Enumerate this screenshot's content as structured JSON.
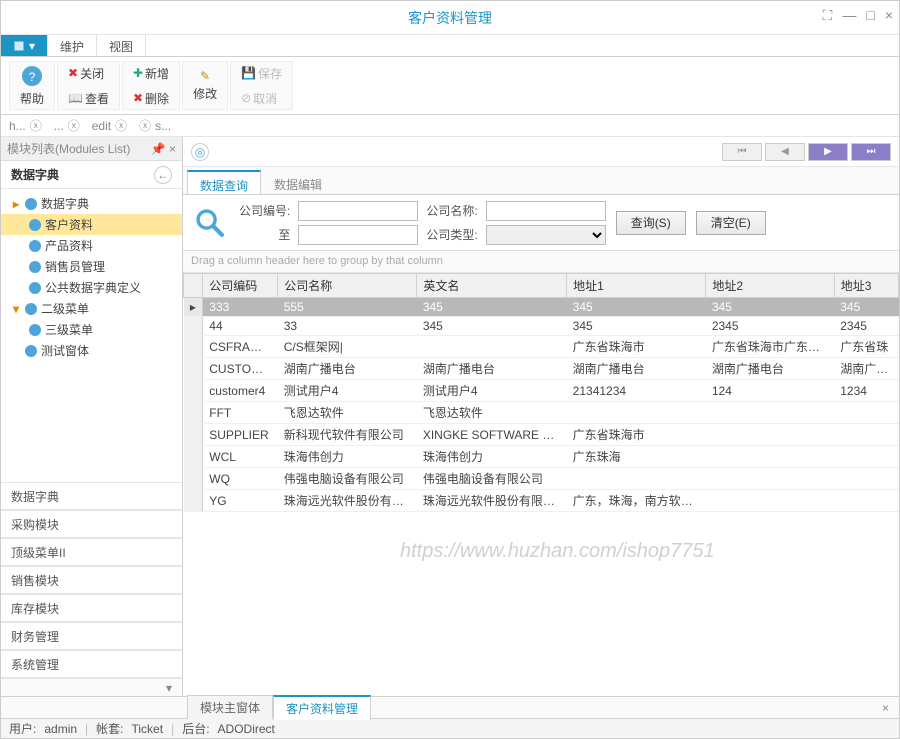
{
  "window": {
    "title": "客户资料管理"
  },
  "ribbon": {
    "tabs": [
      "维护",
      "视图"
    ],
    "help": "帮助",
    "close": "关闭",
    "view": "查看",
    "add": "新增",
    "delete": "删除",
    "modify": "修改",
    "save": "保存",
    "cancel": "取消"
  },
  "subtabs": {
    "h": "h...",
    "edit": "edit",
    "s": "s..."
  },
  "sidebar": {
    "header": "模块列表(Modules List)",
    "section_active": "数据字典",
    "tree": {
      "root": "数据字典",
      "customer": "客户资料",
      "product": "产品资料",
      "sales": "销售员管理",
      "dictdef": "公共数据字典定义",
      "menu2": "二级菜单",
      "menu3": "三级菜单",
      "testform": "测试窗体"
    },
    "sections": [
      "数据字典",
      "采购模块",
      "顶级菜单II",
      "销售模块",
      "库存模块",
      "财务管理",
      "系统管理"
    ]
  },
  "inner_tabs": {
    "query": "数据查询",
    "edit": "数据编辑"
  },
  "search": {
    "company_code": "公司编号:",
    "to": "至",
    "company_name": "公司名称:",
    "company_type": "公司类型:",
    "btn_query": "查询(S)",
    "btn_clear": "清空(E)"
  },
  "grid": {
    "group_hint": "Drag a column header here to group by that column",
    "cols": [
      "公司编码",
      "公司名称",
      "英文名",
      "地址1",
      "地址2",
      "地址3"
    ],
    "rows": [
      {
        "sel": true,
        "c": [
          "333",
          "555",
          "345",
          "345",
          "345",
          "345"
        ]
      },
      {
        "sel": false,
        "c": [
          "44",
          "33",
          "345",
          "345",
          "2345",
          "2345"
        ]
      },
      {
        "sel": false,
        "c": [
          "CSFRAMEW...",
          "C/S框架网|",
          "",
          "广东省珠海市",
          "广东省珠海市广东省珠海市",
          "广东省珠"
        ]
      },
      {
        "sel": false,
        "c": [
          "CUSTOMER",
          "湖南广播电台",
          "湖南广播电台",
          "湖南广播电台",
          "湖南广播电台",
          "湖南广播电"
        ]
      },
      {
        "sel": false,
        "c": [
          "customer4",
          "测试用户4",
          "测试用户4",
          "21341234",
          "124",
          "1234"
        ]
      },
      {
        "sel": false,
        "c": [
          "FFT",
          "飞恩达软件",
          "飞恩达软件",
          "",
          "",
          ""
        ]
      },
      {
        "sel": false,
        "c": [
          "SUPPLIER",
          "新科现代软件有限公司",
          "XINGKE SOFTWARE COMP...",
          "广东省珠海市",
          "",
          ""
        ]
      },
      {
        "sel": false,
        "c": [
          "WCL",
          "珠海伟创力",
          "珠海伟创力",
          "广东珠海",
          "",
          ""
        ]
      },
      {
        "sel": false,
        "c": [
          "WQ",
          "伟强电脑设备有限公司",
          "伟强电脑设备有限公司",
          "",
          "",
          ""
        ]
      },
      {
        "sel": false,
        "c": [
          "YG",
          "珠海远光软件股份有限公司",
          "珠海远光软件股份有限公司",
          "广东，珠海，南方软件园",
          "",
          ""
        ]
      }
    ]
  },
  "bottom_tabs": {
    "main": "模块主窗体",
    "current": "客户资料管理"
  },
  "status": {
    "user_lbl": "用户:",
    "user": "admin",
    "acct_lbl": "帐套:",
    "acct": "Ticket",
    "backend_lbl": "后台:",
    "backend": "ADODirect"
  },
  "watermark": "https://www.huzhan.com/ishop7751"
}
